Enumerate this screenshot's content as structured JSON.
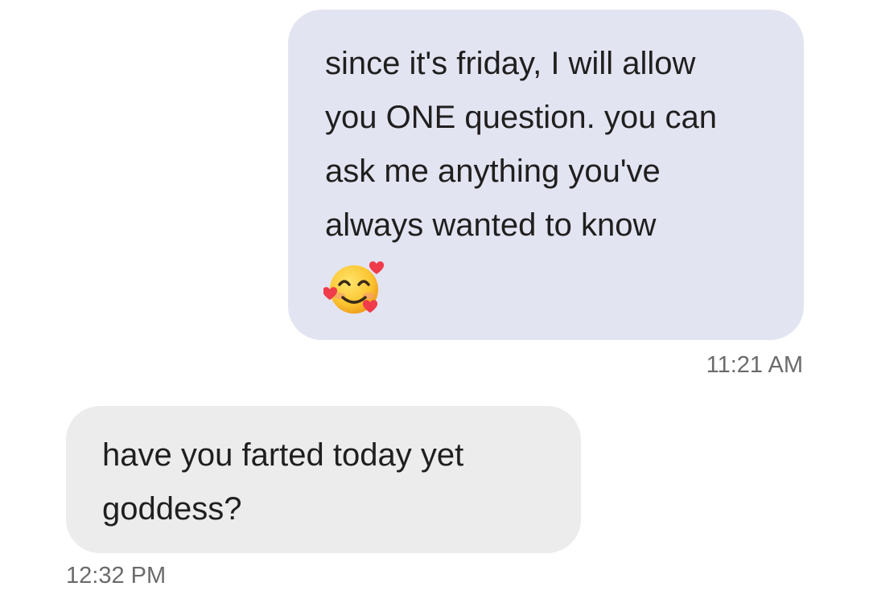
{
  "messages": {
    "outgoing": {
      "lines": [
        "since it's friday, I will allow",
        "you ONE question. you can",
        "ask me anything you've",
        "always wanted to know"
      ],
      "emoji": "smiling-face-with-hearts",
      "timestamp": "11:21 AM"
    },
    "incoming": {
      "lines": [
        "have you farted today yet",
        "goddess?"
      ],
      "timestamp": "12:32 PM"
    }
  },
  "colors": {
    "outgoing_bubble": "#e3e4f1",
    "incoming_bubble": "#ececec",
    "text": "#1f1f1f",
    "timestamp": "#6b6b6b",
    "background": "#ffffff"
  }
}
